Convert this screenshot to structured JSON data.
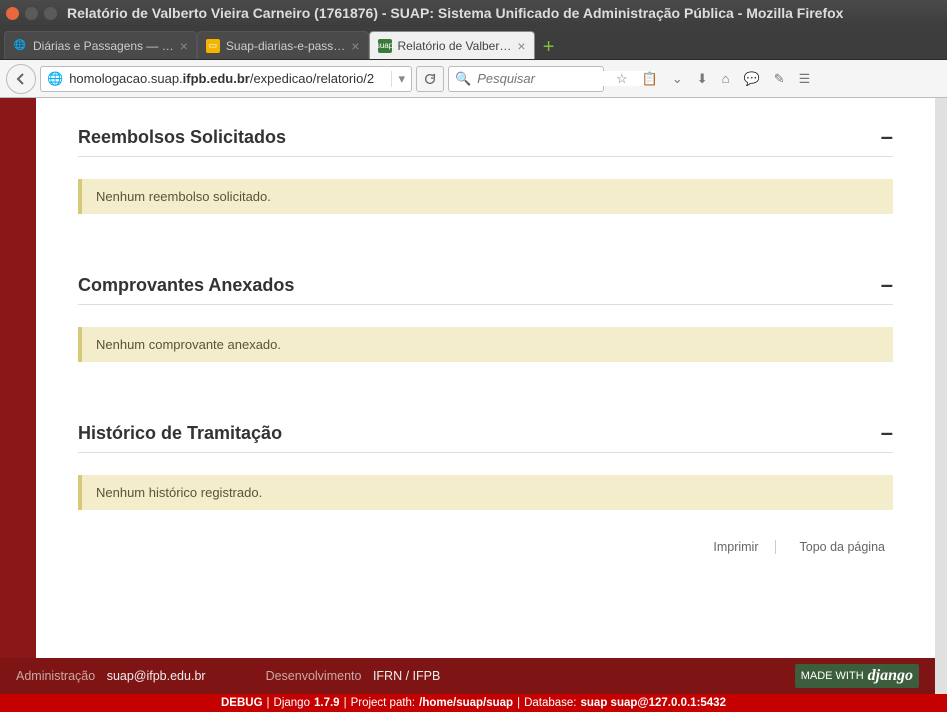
{
  "window": {
    "title": "Relatório de Valberto Vieira Carneiro (1761876) - SUAP: Sistema Unificado de Administração Pública - Mozilla Firefox"
  },
  "tabs": [
    {
      "label": "Diárias e Passagens — …",
      "active": false
    },
    {
      "label": "Suap-diarias-e-pass…",
      "active": false
    },
    {
      "label": "Relatório de Valber…",
      "active": true,
      "badge": "suap"
    }
  ],
  "url": {
    "prefix": "homologacao.suap.",
    "domain": "ifpb.edu.br",
    "path": "/expedicao/relatorio/2"
  },
  "search": {
    "placeholder": "Pesquisar"
  },
  "sections": [
    {
      "title": "Reembolsos Solicitados",
      "message": "Nenhum reembolso solicitado."
    },
    {
      "title": "Comprovantes Anexados",
      "message": "Nenhum comprovante anexado."
    },
    {
      "title": "Histórico de Tramitação",
      "message": "Nenhum histórico registrado."
    }
  ],
  "page_actions": {
    "print": "Imprimir",
    "top": "Topo da página"
  },
  "footer": {
    "admin_label": "Administração",
    "admin_email": "suap@ifpb.edu.br",
    "dev_label": "Desenvolvimento",
    "dev_org": "IFRN / IFPB",
    "badge_prefix": "MADE WITH",
    "badge_name": "django"
  },
  "debug": {
    "mode": "DEBUG",
    "django_label": "Django",
    "django_version": "1.7.9",
    "path_label": "Project path:",
    "path": "/home/suap/suap",
    "db_label": "Database:",
    "db": "suap suap@127.0.0.1:5432"
  }
}
